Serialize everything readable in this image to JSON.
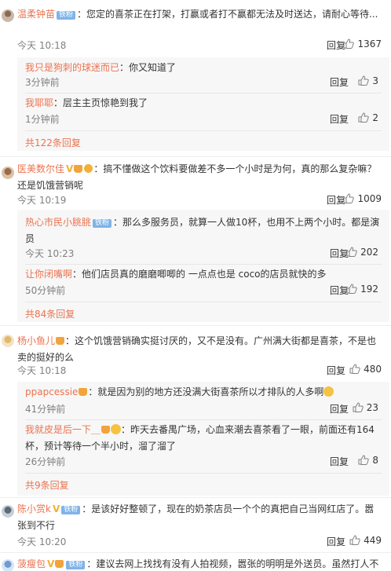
{
  "comments": [
    {
      "user": "温柔钟苗",
      "badge_member": "铁粉",
      "text": "：您定的喜茶正在打架，打赢或者打不赢都无法及时送达，请耐心等待...",
      "time": "今天 10:18",
      "reply": "回复",
      "likes": "1367",
      "replies": [
        {
          "user": "我只是狗刺的球迷而已",
          "text": "：你又知道了",
          "time": "3分钟前",
          "reply": "回复",
          "likes": "3"
        },
        {
          "user": "我耶耶",
          "text": "：层主主页惊艳到我了",
          "time": "1分钟前",
          "reply": "回复",
          "likes": "2"
        }
      ],
      "total": "共122条回复"
    },
    {
      "user": "医美数尔佳",
      "badge_member": "",
      "text": "：搞不懂做这个饮料要做差不多一个小时是为何，真的那么复杂嘛？还是饥饿营销呢",
      "time": "今天 10:19",
      "reply": "回复",
      "likes": "1009",
      "replies": [
        {
          "user": "热心市民小朓朓",
          "badge_member": "铁粉",
          "text": "：那么多服务员，就算一人做10杯，也用不上两个小时。都是演员",
          "time": "今天 10:23",
          "reply": "回复",
          "likes": "202"
        },
        {
          "user": "让你闭嘴啊",
          "text": "：他们店员真的磨磨唧唧的 一点点也是 coco的店员就快的多",
          "time": "50分钟前",
          "reply": "回复",
          "likes": "192"
        }
      ],
      "total": "共84条回复"
    },
    {
      "user": "杨小鱼儿",
      "badge_member": "",
      "text": "：这个饥饿营销确实挺讨厌的，又不是没有。广州满大街都是喜茶，不是也卖的挺好的么",
      "time": "今天 10:18",
      "reply": "回复",
      "likes": "480",
      "replies": [
        {
          "user": "ppapcessie",
          "text": "：就是因为别的地方还没满大街喜茶所以才排队的人多啊",
          "time": "41分钟前",
          "reply": "回复",
          "likes": "23"
        },
        {
          "user": "我就皮是后一下＿",
          "text": "：昨天去番禺广场，心血来潮去喜茶看了一眼，前面还有164杯，预计等待一个半小时，溜了溜了",
          "time": "26分钟前",
          "reply": "回复",
          "likes": "8"
        }
      ],
      "total": "共9条回复"
    },
    {
      "user": "陈小赏k",
      "badge_member": "铁粉",
      "text": "：是该好好整顿了，现在的奶茶店员一个个的真把自己当网红店了。嚣张到不行",
      "time": "今天 10:20",
      "reply": "回复",
      "likes": "449"
    },
    {
      "user": "菠瘦包",
      "badge_member": "铁粉",
      "text": "：建议去网上找找有没有人拍视频，嚣张的明明是外送员。虽然打人不"
    }
  ]
}
